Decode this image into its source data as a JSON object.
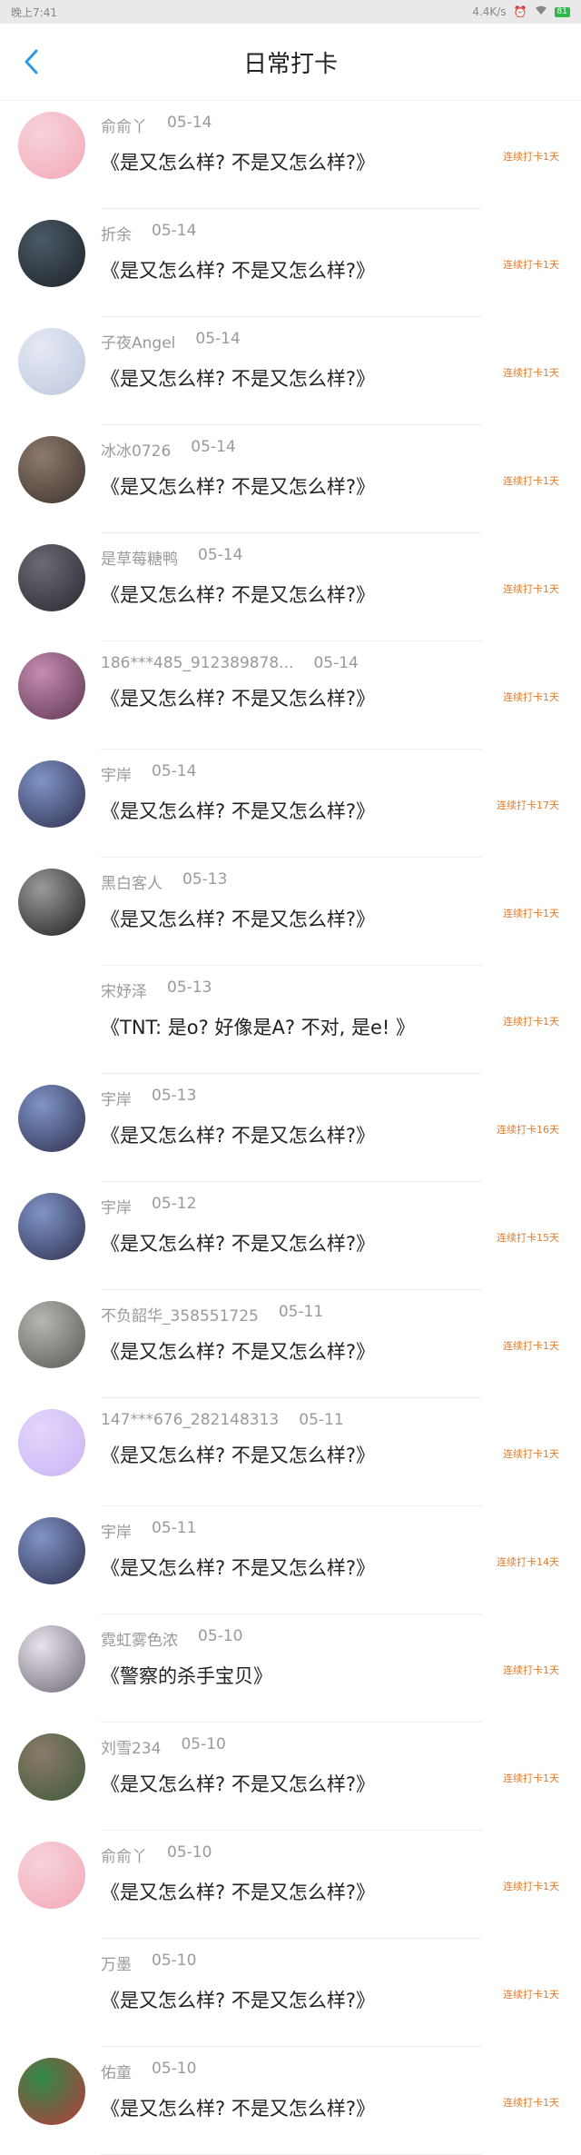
{
  "status_bar": {
    "time": "晚上7:41",
    "speed": "4.4K/s",
    "battery": "81"
  },
  "header": {
    "title": "日常打卡"
  },
  "colors": {
    "accent": "#2a9be0",
    "streak": "#e07b2a"
  },
  "checkins": [
    {
      "name": "俞俞丫",
      "date": "05-14",
      "message": "《是又怎么样? 不是又怎么样?》",
      "streak": "连续打卡1天",
      "avatar": [
        "#f7d3da",
        "#f2a9b7"
      ]
    },
    {
      "name": "折余",
      "date": "05-14",
      "message": "《是又怎么样? 不是又怎么样?》",
      "streak": "连续打卡1天",
      "avatar": [
        "#4b5a66",
        "#1d2228"
      ]
    },
    {
      "name": "子夜Angel",
      "date": "05-14",
      "message": "《是又怎么样? 不是又怎么样?》",
      "streak": "连续打卡1天",
      "avatar": [
        "#e5e9f4",
        "#bcc7dd"
      ]
    },
    {
      "name": "冰冰0726",
      "date": "05-14",
      "message": "《是又怎么样? 不是又怎么样?》",
      "streak": "连续打卡1天",
      "avatar": [
        "#8d7a6c",
        "#3c332e"
      ]
    },
    {
      "name": "是草莓糖鸭",
      "date": "05-14",
      "message": "《是又怎么样? 不是又怎么样?》",
      "streak": "连续打卡1天",
      "avatar": [
        "#6e6a75",
        "#2a2730"
      ]
    },
    {
      "name": "186***485_912389878...",
      "date": "05-14",
      "message": "《是又怎么样? 不是又怎么样?》",
      "streak": "连续打卡1天",
      "avatar": [
        "#c48db2",
        "#5e3450"
      ]
    },
    {
      "name": "宇岸",
      "date": "05-14",
      "message": "《是又怎么样? 不是又怎么样?》",
      "streak": "连续打卡17天",
      "avatar": [
        "#7f94c6",
        "#2f2f4f"
      ]
    },
    {
      "name": "黑白客人",
      "date": "05-13",
      "message": "《是又怎么样? 不是又怎么样?》",
      "streak": "连续打卡1天",
      "avatar": [
        "#9b9b9b",
        "#1f1f1f"
      ]
    },
    {
      "name": "宋妤泽",
      "date": "05-13",
      "message": "《TNT: 是o? 好像是A? 不对, 是e! 》",
      "streak": "连续打卡1天",
      "avatar": [
        "#ffffff",
        "#ffffff"
      ]
    },
    {
      "name": "宇岸",
      "date": "05-13",
      "message": "《是又怎么样? 不是又怎么样?》",
      "streak": "连续打卡16天",
      "avatar": [
        "#7f94c6",
        "#2f2f4f"
      ]
    },
    {
      "name": "宇岸",
      "date": "05-12",
      "message": "《是又怎么样? 不是又怎么样?》",
      "streak": "连续打卡15天",
      "avatar": [
        "#7f94c6",
        "#2f2f4f"
      ]
    },
    {
      "name": "不负韶华_358551725",
      "date": "05-11",
      "message": "《是又怎么样? 不是又怎么样?》",
      "streak": "连续打卡1天",
      "avatar": [
        "#b5b8b0",
        "#565a52"
      ]
    },
    {
      "name": "147***676_282148313",
      "date": "05-11",
      "message": "《是又怎么样? 不是又怎么样?》",
      "streak": "连续打卡1天",
      "avatar": [
        "#e3d6fb",
        "#c9b4f5"
      ]
    },
    {
      "name": "宇岸",
      "date": "05-11",
      "message": "《是又怎么样? 不是又怎么样?》",
      "streak": "连续打卡14天",
      "avatar": [
        "#7f94c6",
        "#2f2f4f"
      ]
    },
    {
      "name": "霓虹雾色浓",
      "date": "05-10",
      "message": "《警察的杀手宝贝》",
      "streak": "连续打卡1天",
      "avatar": [
        "#e8e3ea",
        "#6f6878"
      ]
    },
    {
      "name": "刘雪234",
      "date": "05-10",
      "message": "《是又怎么样? 不是又怎么样?》",
      "streak": "连续打卡1天",
      "avatar": [
        "#8a7a6a",
        "#3f5a3a"
      ]
    },
    {
      "name": "俞俞丫",
      "date": "05-10",
      "message": "《是又怎么样? 不是又怎么样?》",
      "streak": "连续打卡1天",
      "avatar": [
        "#f7d3da",
        "#f2a9b7"
      ]
    },
    {
      "name": "万墨",
      "date": "05-10",
      "message": "《是又怎么样? 不是又怎么样?》",
      "streak": "连续打卡1天",
      "avatar": [
        "#ffffff",
        "#ffffff"
      ]
    },
    {
      "name": "佑童",
      "date": "05-10",
      "message": "《是又怎么样? 不是又怎么样?》",
      "streak": "连续打卡1天",
      "avatar": [
        "#2f8a4a",
        "#b83a3a"
      ]
    }
  ]
}
